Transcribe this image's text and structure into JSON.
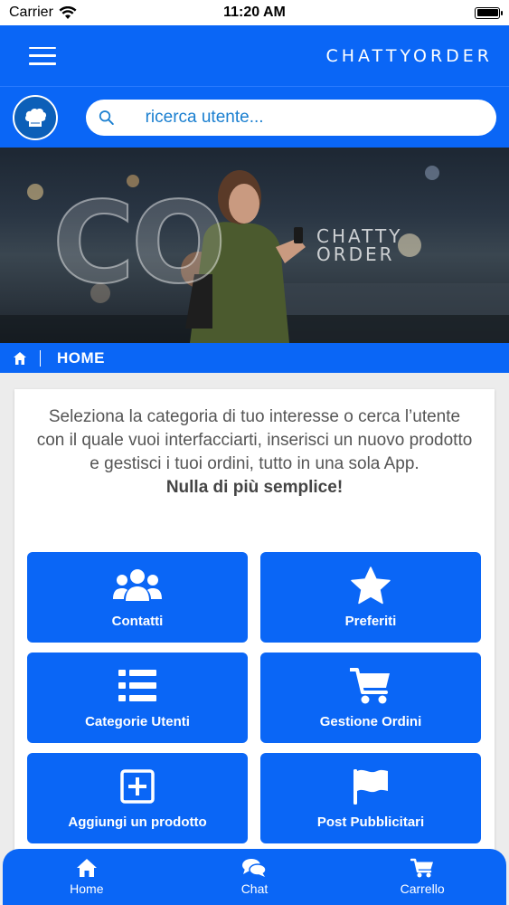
{
  "status_bar": {
    "carrier": "Carrier",
    "time": "11:20 AM",
    "battery_level": 1.0
  },
  "header": {
    "brand": "CHATTYORDER",
    "menu_icon": "hamburger-icon"
  },
  "search": {
    "placeholder": "ricerca utente...",
    "icon": "search-icon",
    "avatar_icon": "chef-hat-icon"
  },
  "hero": {
    "big_text": "CO",
    "logo_line1": "CHATTY",
    "logo_line2": "ORDER"
  },
  "breadcrumb": {
    "icon": "home-icon",
    "title": "HOME"
  },
  "intro": {
    "text": "Seleziona la categoria di tuo interesse o cerca l’utente con il quale vuoi interfacciarti, inserisci un nuovo prodotto e gestisci i tuoi ordini, tutto in una sola App.",
    "emphasis": "Nulla di più semplice!"
  },
  "tiles": [
    {
      "label": "Contatti",
      "icon": "users-icon"
    },
    {
      "label": "Preferiti",
      "icon": "star-icon"
    },
    {
      "label": "Categorie Utenti",
      "icon": "list-icon"
    },
    {
      "label": "Gestione Ordini",
      "icon": "cart-icon"
    },
    {
      "label": "Aggiungi un prodotto",
      "icon": "plus-square-icon"
    },
    {
      "label": "Post Pubblicitari",
      "icon": "flag-icon"
    }
  ],
  "tabbar": [
    {
      "label": "Home",
      "icon": "home-icon"
    },
    {
      "label": "Chat",
      "icon": "chat-icon"
    },
    {
      "label": "Carrello",
      "icon": "cart-icon"
    }
  ],
  "colors": {
    "primary": "#0a66f6",
    "text_muted": "#555555"
  }
}
